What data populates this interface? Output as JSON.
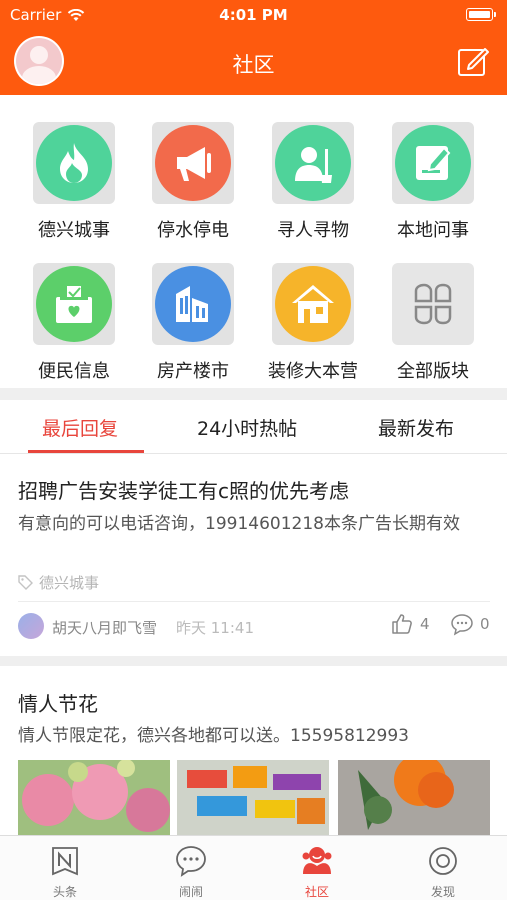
{
  "status_bar": {
    "carrier": "Carrier",
    "time": "4:01 PM"
  },
  "header": {
    "title": "社区"
  },
  "categories": [
    {
      "label": "德兴城事",
      "icon": "flame-icon",
      "color": "#4fd39a"
    },
    {
      "label": "停水停电",
      "icon": "megaphone-icon",
      "color": "#f26a4b"
    },
    {
      "label": "寻人寻物",
      "icon": "person-search-icon",
      "color": "#4fd39a"
    },
    {
      "label": "本地问事",
      "icon": "note-edit-icon",
      "color": "#4fd39a"
    },
    {
      "label": "便民信息",
      "icon": "donation-box-icon",
      "color": "#5ccf6a"
    },
    {
      "label": "房产楼市",
      "icon": "buildings-icon",
      "color": "#4a90e2"
    },
    {
      "label": "装修大本营",
      "icon": "house-icon",
      "color": "#f6b42a"
    },
    {
      "label": "全部版块",
      "icon": "grid-four-icon",
      "color": "#e4e4e4"
    }
  ],
  "tabs": [
    {
      "label": "最后回复",
      "active": true
    },
    {
      "label": "24小时热帖",
      "active": false
    },
    {
      "label": "最新发布",
      "active": false
    }
  ],
  "posts": [
    {
      "title": "招聘广告安装学徒工有c照的优先考虑",
      "body": "有意向的可以电话咨询，19914601218本条广告长期有效",
      "tag": "德兴城事",
      "author": "胡天八月即飞雪",
      "time": "昨天 11:41",
      "likes": "4",
      "comments": "0"
    },
    {
      "title": "情人节花",
      "body": "情人节限定花，德兴各地都可以送。15595812993"
    }
  ],
  "bottom_nav": [
    {
      "label": "头条",
      "icon": "news-icon",
      "active": false
    },
    {
      "label": "闹闹",
      "icon": "chat-bubble-icon",
      "active": false
    },
    {
      "label": "社区",
      "icon": "community-icon",
      "active": true
    },
    {
      "label": "发现",
      "icon": "discover-icon",
      "active": false
    }
  ],
  "colors": {
    "brand": "#fe5a0e",
    "accent": "#e8453c"
  }
}
